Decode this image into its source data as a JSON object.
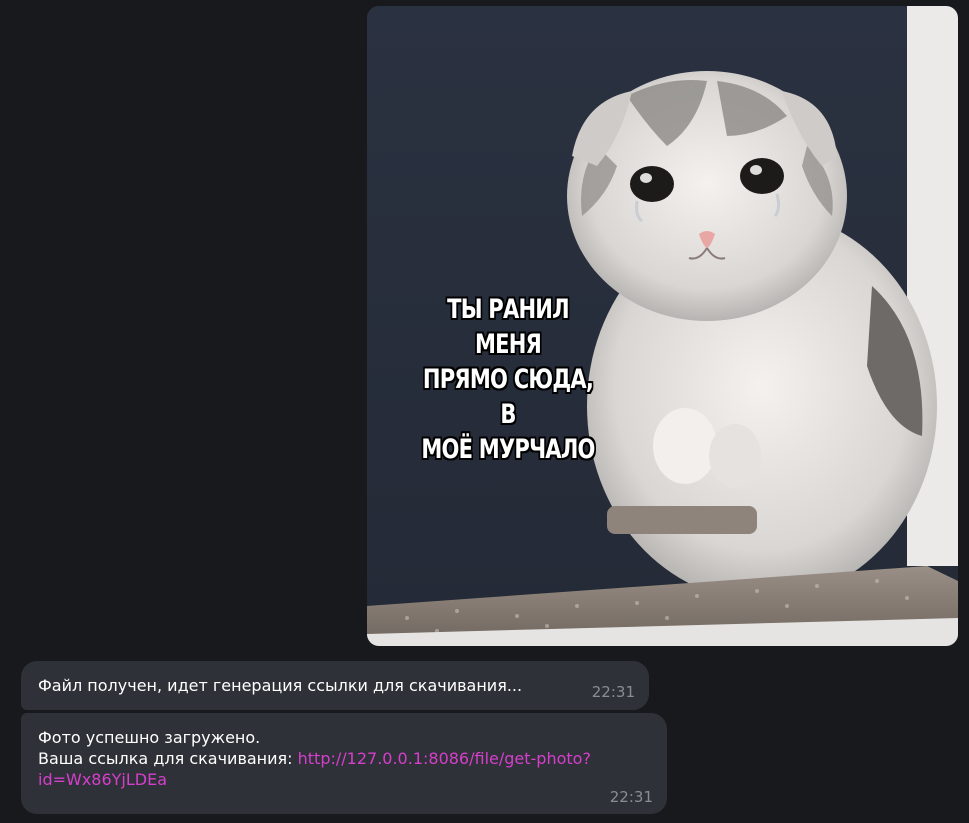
{
  "photo_message": {
    "meme_caption": "ТЫ РАНИЛ МЕНЯ\nПРЯМО СЮДА, В\nМОЁ МУРЧАЛО"
  },
  "messages": [
    {
      "text": "Файл получен, идет генерация ссылки для скачивания...",
      "time": "22:31"
    },
    {
      "line1": "Фото успешно загружено.",
      "line2_prefix": "Ваша ссылка для скачивания: ",
      "link_part1": "http://127.0.0.1:8086/file/get-photo?",
      "link_part2": "id=Wx86YjLDEa",
      "time": "22:31"
    }
  ],
  "colors": {
    "background": "#18191d",
    "bubble": "#2e3137",
    "link": "#d63fcc",
    "timestamp": "#8a8d93"
  }
}
